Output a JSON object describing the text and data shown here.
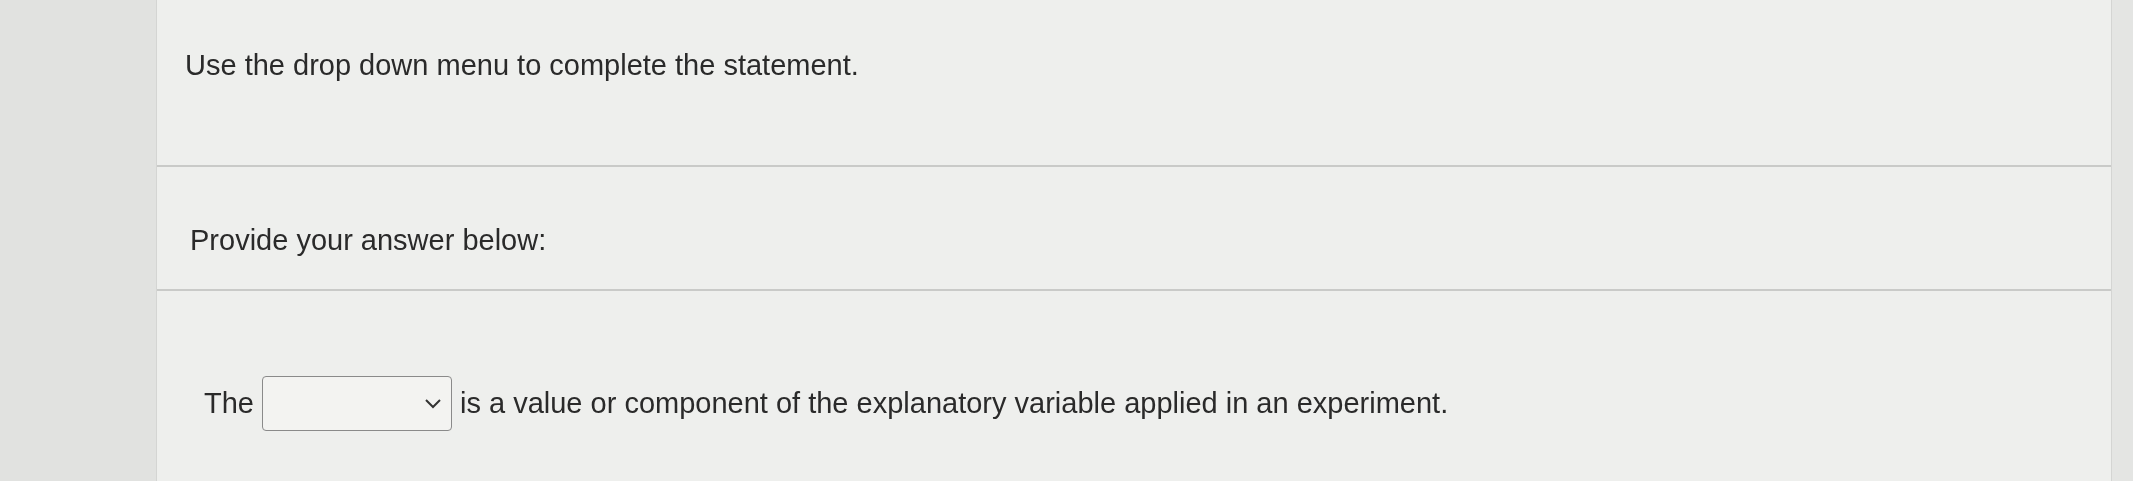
{
  "instruction": "Use the drop down menu to complete the statement.",
  "prompt": "Provide your answer below:",
  "statement": [
    {
      "kind": "text",
      "text": "The"
    },
    {
      "kind": "dropdown"
    },
    {
      "kind": "text",
      "text": "is a value or component of the explanatory variable applied in an experiment."
    }
  ]
}
